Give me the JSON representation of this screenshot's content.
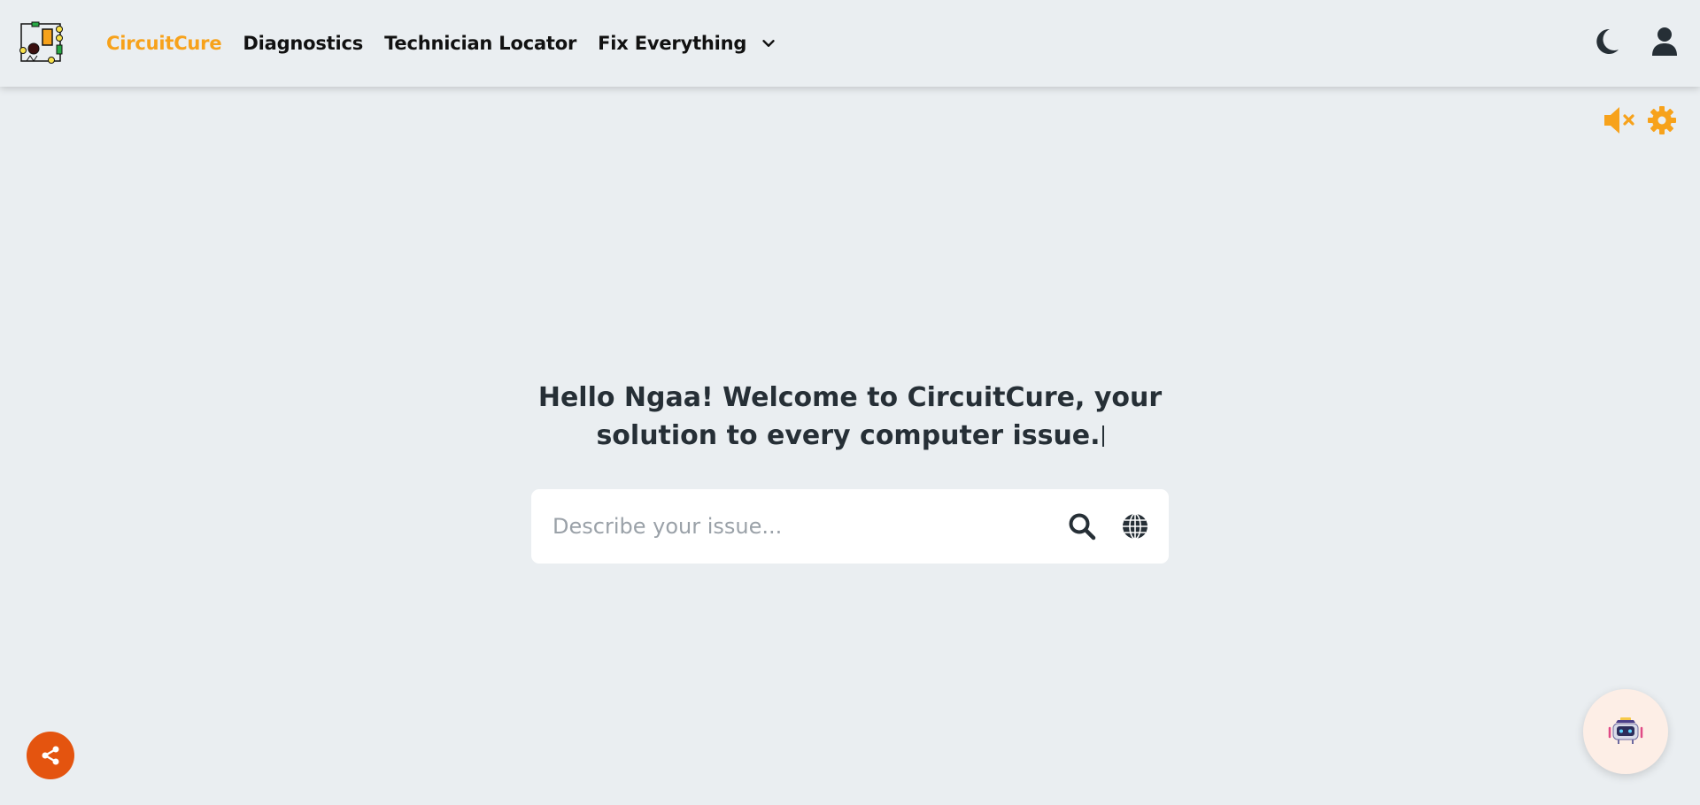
{
  "header": {
    "brand": "CircuitCure",
    "nav": [
      {
        "label": "Diagnostics"
      },
      {
        "label": "Technician Locator"
      },
      {
        "label": "Fix Everything"
      }
    ],
    "icons": [
      "dark-mode-moon-icon",
      "user-icon"
    ]
  },
  "tools": {
    "icons": [
      "sound-muted-icon",
      "settings-gear-icon"
    ]
  },
  "hero": {
    "line1": "Hello Ngaa! Welcome to CircuitCure, your",
    "line2": "solution to every computer issue."
  },
  "search": {
    "placeholder": "Describe your issue...",
    "value": ""
  },
  "colors": {
    "background": "#eaeef1",
    "accent": "#f7a21b",
    "share": "#e4540f",
    "text": "#262f36"
  }
}
